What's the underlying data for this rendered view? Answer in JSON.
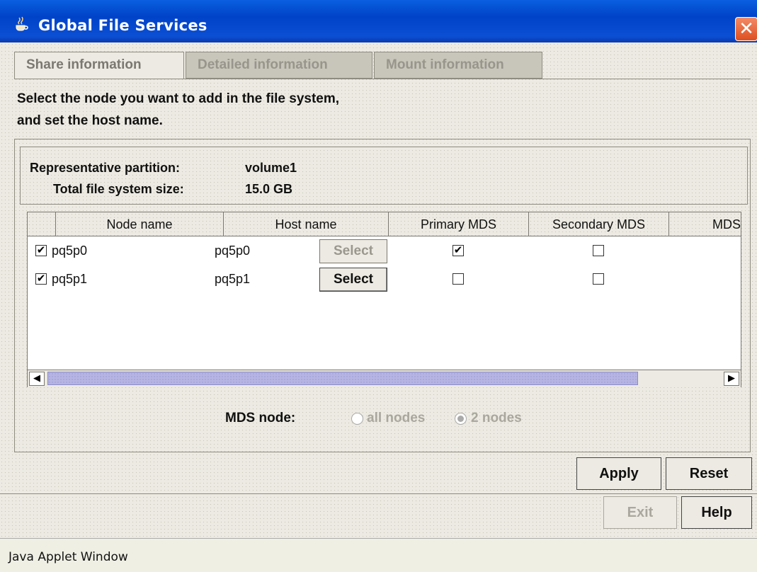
{
  "window": {
    "title": "Global File Services",
    "close_glyph": "✕"
  },
  "tabs": [
    {
      "label": "Share information",
      "active": true
    },
    {
      "label": "Detailed information",
      "active": false
    },
    {
      "label": "Mount information",
      "active": false
    }
  ],
  "instructions": {
    "line1": "Select the node you want to add in the file system,",
    "line2": "and set the host name."
  },
  "info": {
    "partition_label": "Representative partition:",
    "partition_value": "volume1",
    "size_label": "Total file system size:",
    "size_value": "15.0 GB"
  },
  "table": {
    "columns": [
      "Node name",
      "Host name",
      "Primary MDS",
      "Secondary MDS",
      "MDS"
    ],
    "rows": [
      {
        "checked": true,
        "node": "pq5p0",
        "host": "pq5p0",
        "select_label": "Select",
        "select_enabled": false,
        "primary": true,
        "secondary": false
      },
      {
        "checked": true,
        "node": "pq5p1",
        "host": "pq5p1",
        "select_label": "Select",
        "select_enabled": true,
        "primary": false,
        "secondary": false
      }
    ]
  },
  "scrollbar": {
    "left_arrow": "◀",
    "right_arrow": "▶"
  },
  "mds_node": {
    "label": "MDS node:",
    "options": [
      {
        "label": "all nodes",
        "selected": false
      },
      {
        "label": "2 nodes",
        "selected": true
      }
    ]
  },
  "buttons": {
    "apply": "Apply",
    "reset": "Reset",
    "exit": "Exit",
    "help": "Help"
  },
  "status": {
    "text": "Java Applet Window"
  },
  "colors": {
    "titlebar": "#0a4fd4",
    "background": "#eceae2",
    "close": "#dd4f20",
    "scroll_thumb": "#b5b4e2"
  }
}
